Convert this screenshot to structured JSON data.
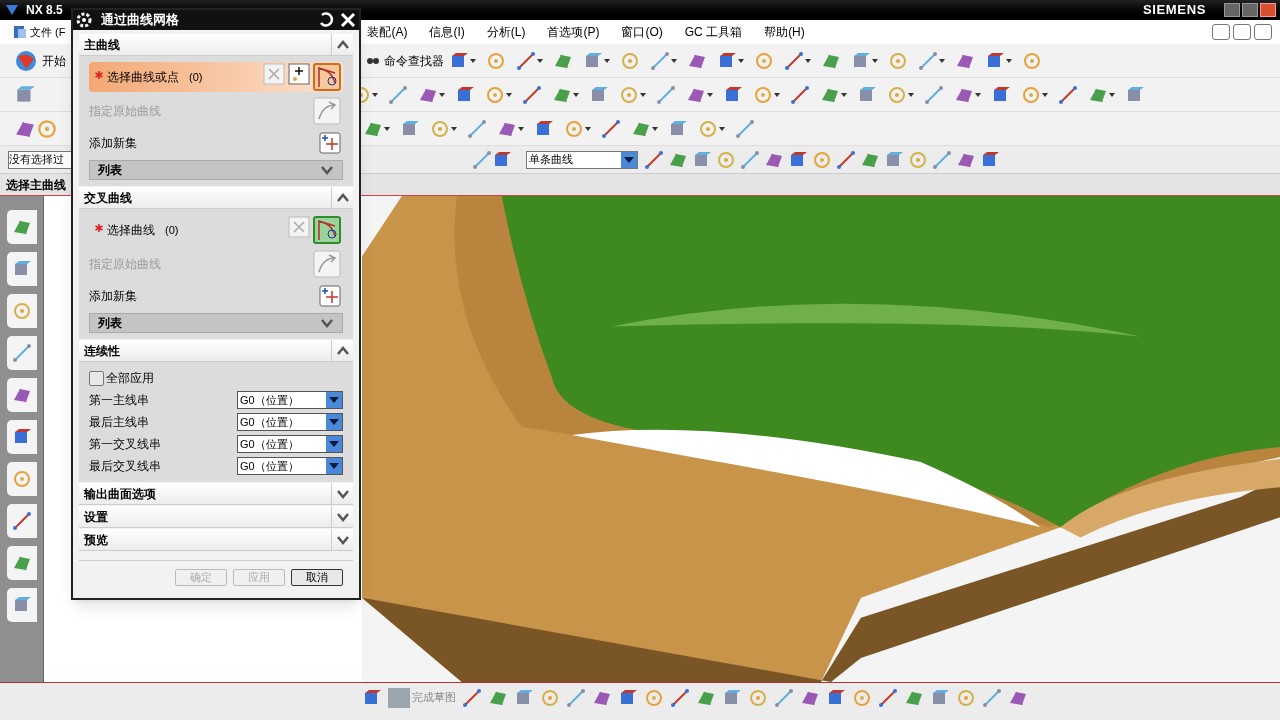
{
  "window": {
    "title": "NX 8.5",
    "brand": "SIEMENS"
  },
  "menu": [
    {
      "label": "文件 (F"
    },
    {
      "label": "装配(A)"
    },
    {
      "label": "信息(I)"
    },
    {
      "label": "分析(L)"
    },
    {
      "label": "首选项(P)"
    },
    {
      "label": "窗口(O)"
    },
    {
      "label": "GC 工具箱"
    },
    {
      "label": "帮助(H)"
    }
  ],
  "toolbar": {
    "start": "开始",
    "command_finder": "命令查找器"
  },
  "selection_bar": {
    "filter": "没有选择过",
    "curve_rule": "单条曲线"
  },
  "cue_line": "选择主曲线",
  "dialog": {
    "title": "通过曲线网格",
    "sections": [
      {
        "kind": "curves",
        "title": "主曲线",
        "expanded": true,
        "select_label": "选择曲线或点",
        "count": "(0)",
        "selected": true,
        "origin_label": "指定原始曲线",
        "add_label": "添加新集",
        "list_label": "列表"
      },
      {
        "kind": "curves",
        "title": "交叉曲线",
        "expanded": true,
        "select_label": "选择曲线",
        "count": "(0)",
        "selected": false,
        "origin_label": "指定原始曲线",
        "add_label": "添加新集",
        "list_label": "列表"
      },
      {
        "kind": "continuity",
        "title": "连续性",
        "expanded": true,
        "apply_all": {
          "label": "全部应用",
          "checked": false
        },
        "rows": [
          {
            "label": "第一主线串",
            "value": "G0（位置）"
          },
          {
            "label": "最后主线串",
            "value": "G0（位置）"
          },
          {
            "label": "第一交叉线串",
            "value": "G0（位置）"
          },
          {
            "label": "最后交叉线串",
            "value": "G0（位置）"
          }
        ]
      },
      {
        "title": "输出曲面选项",
        "expanded": false
      },
      {
        "title": "设置",
        "expanded": false
      },
      {
        "title": "预览",
        "expanded": false
      }
    ],
    "buttons": [
      {
        "label": "确定",
        "disabled": true
      },
      {
        "label": "应用",
        "disabled": true
      },
      {
        "label": "取消",
        "disabled": false
      }
    ]
  },
  "sketch_toolbar": {
    "finish_label": "完成草图"
  }
}
